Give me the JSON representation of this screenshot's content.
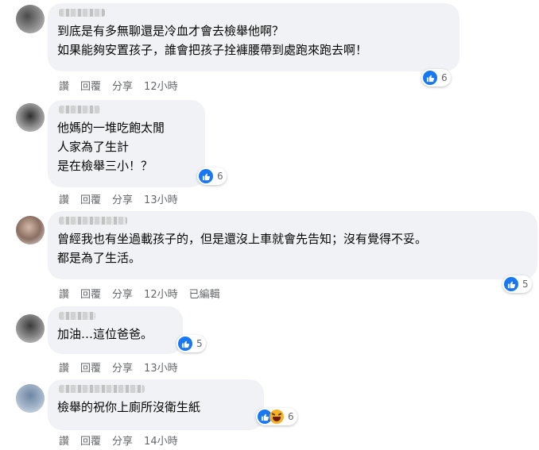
{
  "comments": [
    {
      "lines": [
        "到底是有多無聊還是冷血才會去檢舉他啊？",
        "如果能夠安置孩子，誰會把孩子拴褲腰帶到處跑來跑去啊！"
      ],
      "reaction_count": "6",
      "actions": {
        "like": "讚",
        "reply": "回覆",
        "share": "分享",
        "time": "12小時",
        "edited": ""
      }
    },
    {
      "lines": [
        "他媽的一堆吃飽太閒",
        "人家為了生計",
        "是在檢舉三小！？"
      ],
      "reaction_count": "6",
      "actions": {
        "like": "讚",
        "reply": "回覆",
        "share": "分享",
        "time": "13小時",
        "edited": ""
      }
    },
    {
      "lines": [
        "曾經我也有坐過載孩子的，但是還沒上車就會先告知；沒有覺得不妥。",
        "都是為了生活。"
      ],
      "reaction_count": "5",
      "actions": {
        "like": "讚",
        "reply": "回覆",
        "share": "分享",
        "time": "12小時",
        "edited": "已編輯"
      }
    },
    {
      "lines": [
        "加油…這位爸爸。"
      ],
      "reaction_count": "5",
      "actions": {
        "like": "讚",
        "reply": "回覆",
        "share": "分享",
        "time": "13小時",
        "edited": ""
      }
    },
    {
      "lines": [
        "檢舉的祝你上廁所沒衛生紙"
      ],
      "reaction_count": "6",
      "actions": {
        "like": "讚",
        "reply": "回覆",
        "share": "分享",
        "time": "14小時",
        "edited": ""
      }
    }
  ],
  "colors": {
    "bubble": "#f0f2f5",
    "like_blue": "#1877f2",
    "meta_grey": "#65676b",
    "haha_yellow": "#f7b125"
  }
}
